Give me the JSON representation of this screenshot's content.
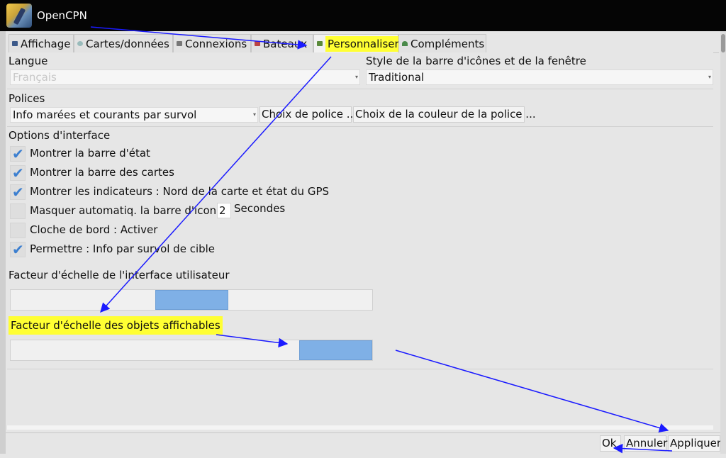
{
  "window": {
    "title": "OpenCPN"
  },
  "tabs": [
    {
      "label": "Affichage",
      "icon": "display-icon"
    },
    {
      "label": "Cartes/données",
      "icon": "charts-icon"
    },
    {
      "label": "Connexions",
      "icon": "connections-icon"
    },
    {
      "label": "Bateaux",
      "icon": "ships-icon"
    },
    {
      "label": "Personnaliser",
      "icon": "user-interface-icon",
      "active": true
    },
    {
      "label": "Compléments",
      "icon": "plugins-icon"
    }
  ],
  "language": {
    "label": "Langue",
    "value": "Français"
  },
  "style": {
    "label": "Style de la barre d'icônes et de la fenêtre",
    "value": "Traditional"
  },
  "fonts": {
    "label": "Polices",
    "select_value": "Info marées et courants par survol",
    "choose_font": "Choix de police ...",
    "choose_color": "Choix de la couleur de la police ..."
  },
  "interface": {
    "label": "Options d'interface",
    "options": [
      {
        "label": "Montrer la barre d'état",
        "checked": true
      },
      {
        "label": "Montrer la barre des cartes",
        "checked": true
      },
      {
        "label": "Montrer les indicateurs : Nord de la carte et état du GPS",
        "checked": true
      },
      {
        "label": "Masquer automatiq. la barre d'icones",
        "checked": false,
        "value": "2",
        "unit": "Secondes"
      },
      {
        "label": "Cloche de bord : Activer",
        "checked": false
      },
      {
        "label": "Permettre : Info par survol de cible",
        "checked": true
      }
    ]
  },
  "ui_scale": {
    "label": "Facteur d'échelle de l'interface utilisateur",
    "level": 0.5
  },
  "object_scale": {
    "label": "Facteur d'échelle des objets affichables",
    "level": 1.0
  },
  "footer": {
    "ok": "Ok",
    "cancel": "Annuler",
    "apply": "Appliquer"
  },
  "colors": {
    "highlight": "#ffff33",
    "slider_thumb": "#7fb0e6",
    "annotation_arrow": "#1a1aff",
    "titlebar": "#050505"
  }
}
